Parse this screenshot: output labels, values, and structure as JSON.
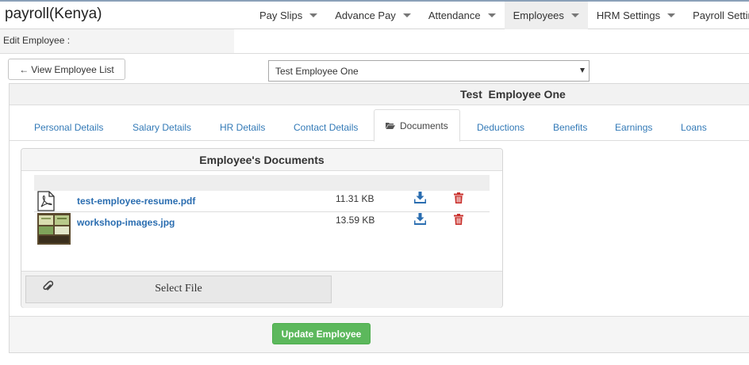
{
  "app": {
    "title": "payroll(Kenya)"
  },
  "nav": {
    "items": [
      {
        "label": "Pay Slips"
      },
      {
        "label": "Advance Pay"
      },
      {
        "label": "Attendance"
      },
      {
        "label": "Employees",
        "active": true
      },
      {
        "label": "HRM Settings"
      },
      {
        "label": "Payroll Settings"
      }
    ]
  },
  "subheader": {
    "title": "Edit Employee :"
  },
  "toolbar": {
    "view_list_arrow": "←",
    "view_list_label": "View Employee List"
  },
  "employee_select": {
    "selected": "Test Employee One"
  },
  "panel": {
    "title": "Test  Employee One"
  },
  "tabs": [
    {
      "label": "Personal Details"
    },
    {
      "label": "Salary Details"
    },
    {
      "label": "HR Details"
    },
    {
      "label": "Contact Details"
    },
    {
      "label": "Documents",
      "active": true,
      "icon": "folder-open-icon"
    },
    {
      "label": "Deductions"
    },
    {
      "label": "Benefits"
    },
    {
      "label": "Earnings"
    },
    {
      "label": "Loans"
    }
  ],
  "documents": {
    "title": "Employee's Documents",
    "rows": [
      {
        "name": "test-employee-resume.pdf",
        "size": "11.31 KB",
        "thumb": "pdf-file-icon"
      },
      {
        "name": "workshop-images.jpg",
        "size": "13.59 KB",
        "thumb": "image-thumbnail"
      }
    ],
    "select_file_label": "Select File"
  },
  "actions": {
    "update_label": "Update Employee"
  },
  "colors": {
    "link": "#337ab7",
    "doc_link": "#2a6db0",
    "success": "#5cb85c",
    "danger": "#c9302c",
    "download": "#2a6db0"
  }
}
